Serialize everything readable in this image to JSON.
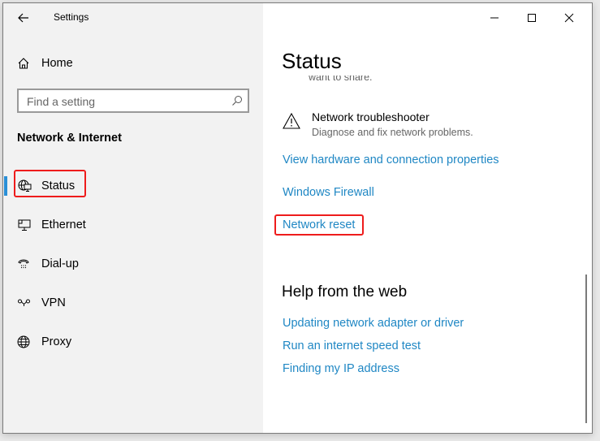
{
  "window": {
    "title": "Settings",
    "controls": {
      "minimize": "minimize",
      "maximize": "maximize",
      "close": "close"
    }
  },
  "sidebar": {
    "home_label": "Home",
    "search_placeholder": "Find a setting",
    "section_title": "Network & Internet",
    "items": [
      {
        "label": "Status",
        "icon": "globe-monitor-icon",
        "selected": true
      },
      {
        "label": "Ethernet",
        "icon": "ethernet-icon",
        "selected": false
      },
      {
        "label": "Dial-up",
        "icon": "phone-icon",
        "selected": false
      },
      {
        "label": "VPN",
        "icon": "vpn-icon",
        "selected": false
      },
      {
        "label": "Proxy",
        "icon": "globe-icon",
        "selected": false
      }
    ],
    "accent_color": "#2a8fd6"
  },
  "main": {
    "page_title": "Status",
    "clipped_text": "want to share.",
    "troubleshooter": {
      "title": "Network troubleshooter",
      "description": "Diagnose and fix network problems."
    },
    "links": [
      "View hardware and connection properties",
      "Windows Firewall",
      "Network reset"
    ],
    "help": {
      "title": "Help from the web",
      "links": [
        "Updating network adapter or driver",
        "Run an internet speed test",
        "Finding my IP address"
      ]
    },
    "link_color": "#1f87c4",
    "highlight_color": "#ee1c1c"
  }
}
